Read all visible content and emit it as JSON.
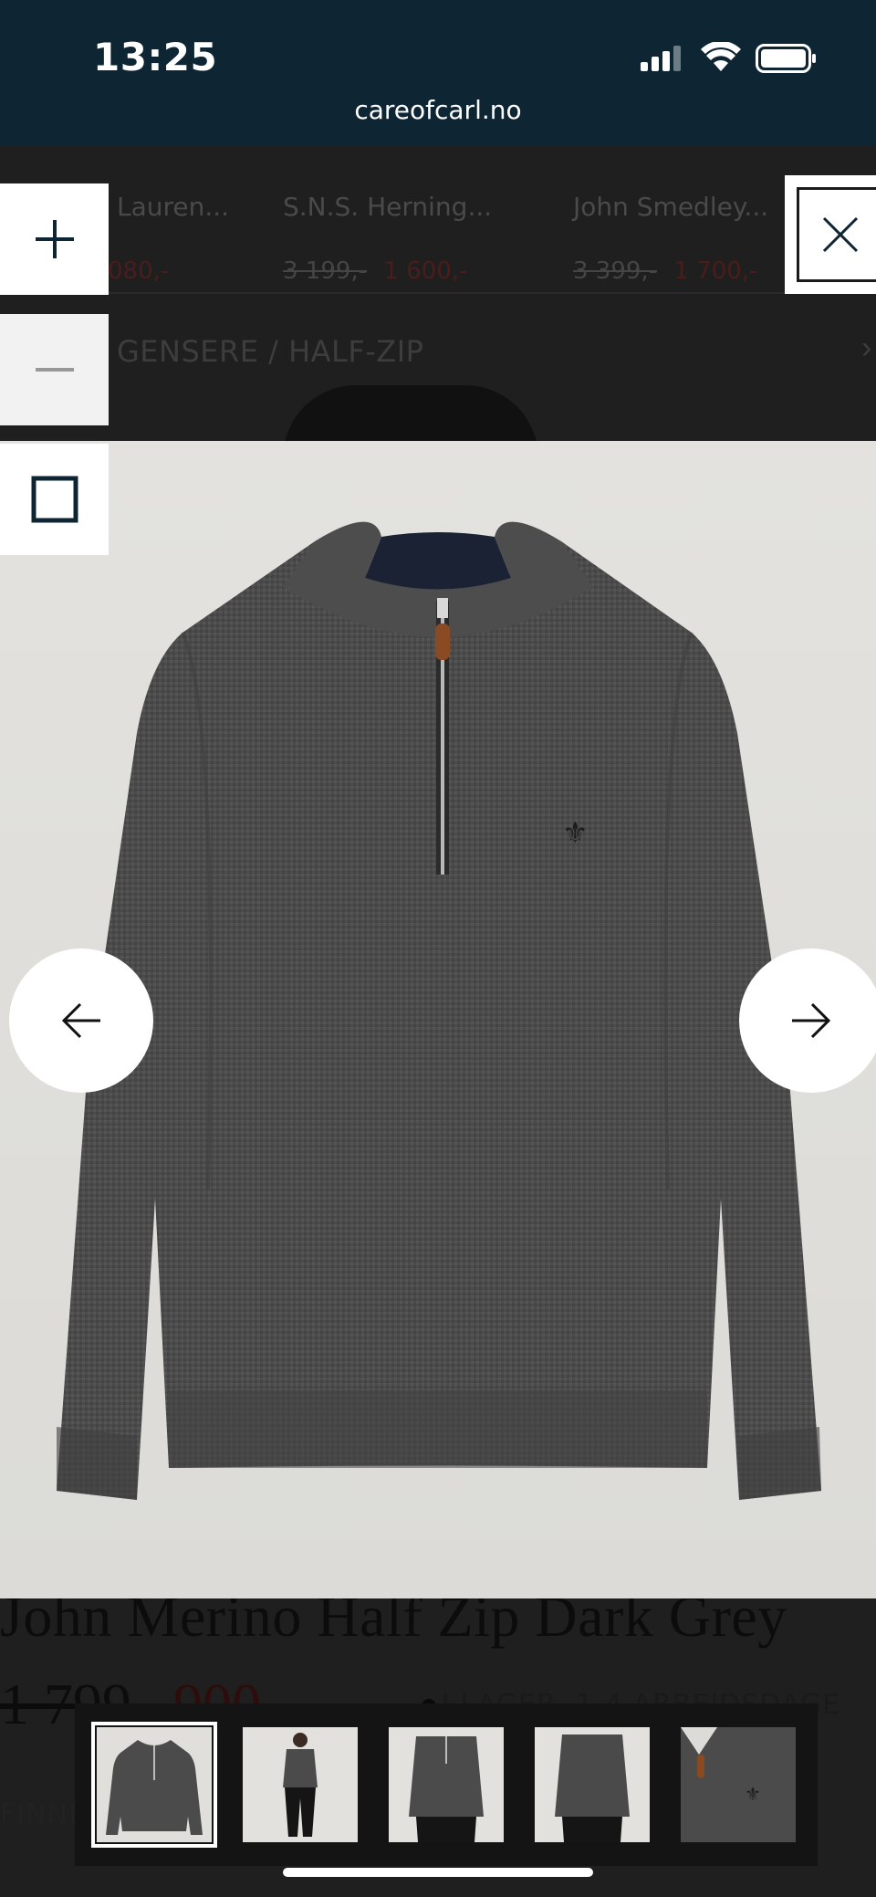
{
  "status_bar": {
    "time": "13:25",
    "url": "careofcarl.no"
  },
  "recommendations": [
    {
      "name": "Lauren...",
      "old_price": "",
      "price": "080,-"
    },
    {
      "name": "S.N.S. Herning...",
      "old_price": "3 199,-",
      "price": "1 600,-"
    },
    {
      "name": "John Smedley...",
      "old_price": "3 399,-",
      "price": "1 700,-"
    }
  ],
  "breadcrumb": "GENSERE / HALF-ZIP",
  "product": {
    "title": "John Merino Half Zip Dark Grey",
    "old_price": "1 799,-",
    "price": "900,-",
    "stock": "I LAGER, 1-4 ARBEIDSDAGE",
    "find_store": "FINNE",
    "find_store_tail": "FA"
  },
  "lightbox": {
    "zoom_in_icon": "plus-icon",
    "zoom_out_icon": "minus-icon",
    "fit_icon": "square-icon",
    "close_icon": "close-icon",
    "prev_icon": "arrow-left-icon",
    "next_icon": "arrow-right-icon",
    "active_thumbnail": 0,
    "thumbnail_count": 5
  },
  "colors": {
    "status_bar_bg": "#0e2533",
    "sweater": "#4a4a4a",
    "backdrop": "#e0dfdb"
  }
}
